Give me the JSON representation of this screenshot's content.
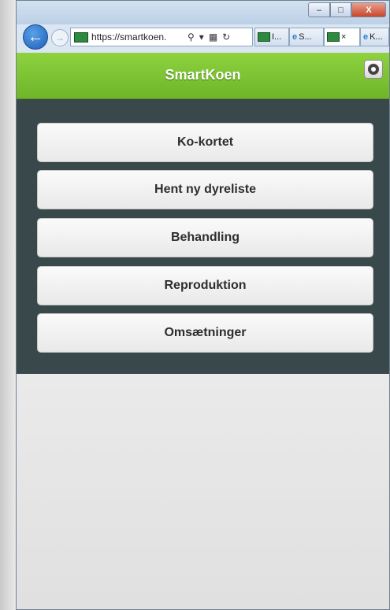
{
  "browser": {
    "address": "https://smartkoen.",
    "tabs": [
      {
        "label": "I...",
        "icon": "dlbr-favicon"
      },
      {
        "label": "S...",
        "icon": "ie-icon"
      },
      {
        "label": "×",
        "icon": "dlbr-favicon"
      },
      {
        "label": "K...",
        "icon": "ie-icon"
      }
    ],
    "controls": {
      "minimize": "–",
      "maximize": "□",
      "close": "X"
    }
  },
  "app": {
    "title": "SmartKoen",
    "header_color": "#7fc235",
    "menu": [
      {
        "label": "Ko-kortet"
      },
      {
        "label": "Hent ny dyreliste"
      },
      {
        "label": "Behandling"
      },
      {
        "label": "Reproduktion"
      },
      {
        "label": "Omsætninger"
      }
    ]
  }
}
